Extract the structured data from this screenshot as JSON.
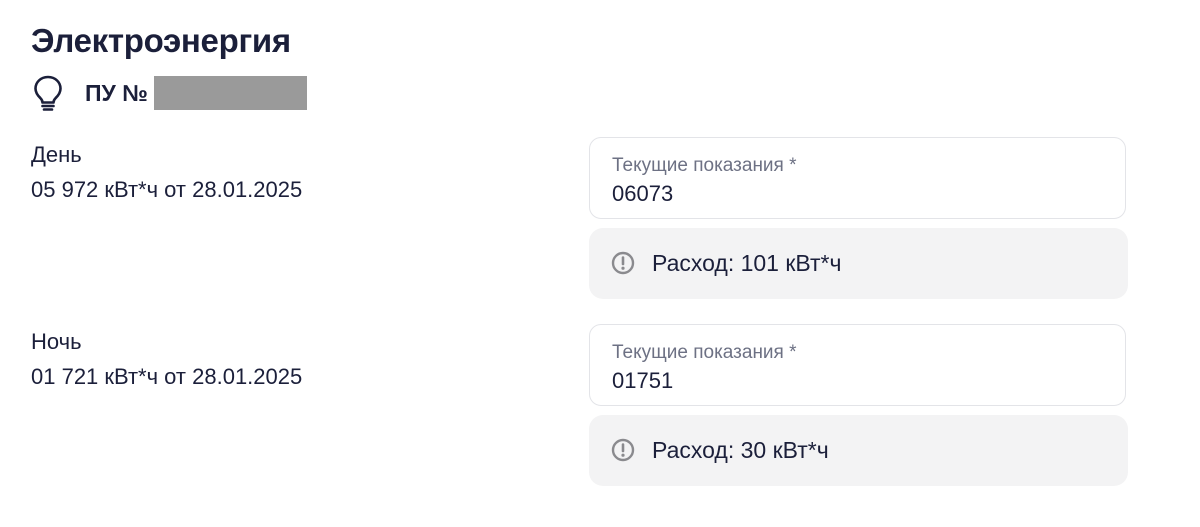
{
  "section": {
    "title": "Электроэнергия",
    "meter_label": "ПУ №",
    "icon": "lightbulb-icon"
  },
  "readings": [
    {
      "name": "День",
      "previous": "05 972 кВт*ч от 28.01.2025",
      "input_label": "Текущие показания *",
      "input_value": "06073",
      "consumption": "Расход: 101 кВт*ч"
    },
    {
      "name": "Ночь",
      "previous": "01 721 кВт*ч от 28.01.2025",
      "input_label": "Текущие показания *",
      "input_value": "01751",
      "consumption": "Расход: 30 кВт*ч"
    }
  ],
  "colors": {
    "text": "#1b1f3a",
    "label": "#6d7184",
    "info_bg": "#f3f3f4",
    "border": "#e3e4e8",
    "redaction": "#9a9a9a"
  }
}
